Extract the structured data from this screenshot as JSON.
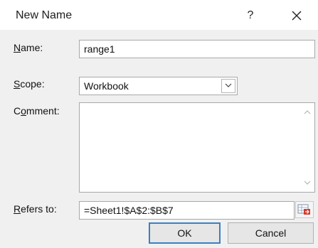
{
  "window": {
    "title": "New Name",
    "help_label": "?",
    "close_label": "✕"
  },
  "form": {
    "name": {
      "label_accel": "N",
      "label_rest": "ame:",
      "value": "range1"
    },
    "scope": {
      "label_accel": "S",
      "label_rest": "cope:",
      "value": "Workbook"
    },
    "comment": {
      "label_pre": "C",
      "label_accel": "o",
      "label_rest": "mment:",
      "value": ""
    },
    "refers_to": {
      "label_accel": "R",
      "label_rest": "efers to:",
      "value": "=Sheet1!$A$2:$B$7"
    }
  },
  "buttons": {
    "ok_label": "OK",
    "cancel_label": "Cancel"
  },
  "icons": {
    "combo": "chevron-down-icon",
    "scroll_up": "scroll-up-arrow-icon",
    "scroll_down": "scroll-down-arrow-icon",
    "range_picker": "collapse-dialog-icon",
    "close": "close-icon"
  },
  "colors": {
    "default_button_border": "#3c7fc3",
    "field_border": "#a8a8a8"
  }
}
